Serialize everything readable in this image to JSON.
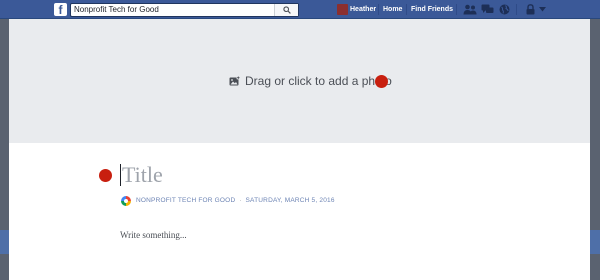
{
  "topbar": {
    "logo": "f",
    "search": {
      "value": "Nonprofit Tech for Good",
      "icon": "search-icon"
    },
    "user_name": "Heather",
    "home_label": "Home",
    "find_friends_label": "Find Friends",
    "icons": [
      "friend-requests-icon",
      "messages-icon",
      "notifications-globe-icon",
      "lock-icon",
      "chevron-down-icon"
    ],
    "colors": {
      "bar": "#3b5998"
    }
  },
  "editor": {
    "cover_prompt": "Drag or click to add a photo",
    "cover_icon": "add-photo-icon",
    "title_placeholder": "Title",
    "byline": {
      "page_name": "NONPROFIT TECH FOR GOOD",
      "separator": "·",
      "date": "SATURDAY, MARCH 5, 2016"
    },
    "body_placeholder": "Write something...",
    "colors": {
      "cover_bg": "#e9ebee",
      "marker": "#c81f0f",
      "byline": "#6d84b4"
    }
  }
}
